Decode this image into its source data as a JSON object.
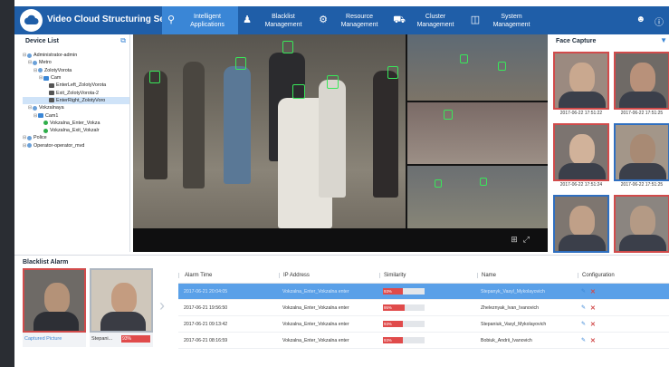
{
  "app": {
    "title": "Video Cloud Structuring Server"
  },
  "nav": [
    {
      "label": "Intelligent Applications",
      "icon": "search-icon",
      "active": true
    },
    {
      "label": "Blacklist Management",
      "icon": "person-icon",
      "active": false
    },
    {
      "label": "Resource Management",
      "icon": "gear-icon",
      "active": false
    },
    {
      "label": "Cluster Management",
      "icon": "truck-icon",
      "active": false
    },
    {
      "label": "System Management",
      "icon": "monitor-icon",
      "active": false
    }
  ],
  "device_list": {
    "title": "Device List",
    "nodes": [
      {
        "label": "Administrator-admin",
        "level": 0,
        "type": "user",
        "selected": false
      },
      {
        "label": "Metro",
        "level": 1,
        "type": "user",
        "selected": false
      },
      {
        "label": "ZolotyVorota",
        "level": 2,
        "type": "user",
        "selected": false
      },
      {
        "label": "Cam",
        "level": 3,
        "type": "group",
        "selected": false
      },
      {
        "label": "EnterLeft_ZolotyVorota",
        "level": 4,
        "type": "camera",
        "selected": false
      },
      {
        "label": "Exit_ZolotyVorota-2",
        "level": 4,
        "type": "camera",
        "selected": false
      },
      {
        "label": "EnterRight_ZolotyVoro",
        "level": 4,
        "type": "camera",
        "selected": true
      },
      {
        "label": "Vokzalnaya",
        "level": 1,
        "type": "user",
        "selected": false
      },
      {
        "label": "Cam1",
        "level": 2,
        "type": "group",
        "selected": false
      },
      {
        "label": "Vokzalna_Enter_Vokza",
        "level": 3,
        "type": "online",
        "selected": false
      },
      {
        "label": "Vokzalna_Exit_Vokzalr",
        "level": 3,
        "type": "online",
        "selected": false
      },
      {
        "label": "Police",
        "level": 0,
        "type": "user",
        "selected": false
      },
      {
        "label": "Operator-operator_mvd",
        "level": 0,
        "type": "user",
        "selected": false
      }
    ]
  },
  "face_capture": {
    "title": "Face Capture",
    "items": [
      {
        "time": "2017-06-22 17:51:22",
        "border": "red"
      },
      {
        "time": "2017-06-22 17:51:25",
        "border": "red"
      },
      {
        "time": "2017-06-22 17:51:24",
        "border": "red"
      },
      {
        "time": "2017-06-22 17:51:25",
        "border": "blue"
      },
      {
        "time": "",
        "border": "blue"
      },
      {
        "time": "",
        "border": "red"
      }
    ]
  },
  "blacklist_alarm": {
    "title": "Blacklist Alarm",
    "captured_label": "Captured Picture",
    "matched_name": "Stepani...",
    "matched_similarity": "93%",
    "columns": [
      "Alarm Time",
      "IP Address",
      "Similarity",
      "Name",
      "Configuration"
    ],
    "rows": [
      {
        "time": "2017-06-21 20:04:05",
        "ip": "Vokzalna_Enter_Vokzalna enter",
        "similarity": 93,
        "similarity_label": "93%",
        "name": "Stepanyk_Vasyl_Mykolayovich",
        "selected": true
      },
      {
        "time": "2017-06-21 19:56:50",
        "ip": "Vokzalna_Enter_Vokzalna enter",
        "similarity": 95,
        "similarity_label": "95%",
        "name": "Zheleznyak_Ivan_Ivanovich",
        "selected": false
      },
      {
        "time": "2017-06-21 09:13:42",
        "ip": "Vokzalna_Enter_Vokzalna enter",
        "similarity": 93,
        "similarity_label": "93%",
        "name": "Stepaniuk_Vasyl_Mykolayovich",
        "selected": false
      },
      {
        "time": "2017-06-21 08:16:59",
        "ip": "Vokzalna_Enter_Vokzalna enter",
        "similarity": 93,
        "similarity_label": "93%",
        "name": "Bobiuk_Andrii_Ivanovich",
        "selected": false
      }
    ]
  },
  "colors": {
    "topbar": "#1f5ea8",
    "active_nav": "#3a86d6",
    "alarm_red": "#e04b4b",
    "face_box": "#39e85a",
    "selected_row": "#5aa0e8"
  }
}
